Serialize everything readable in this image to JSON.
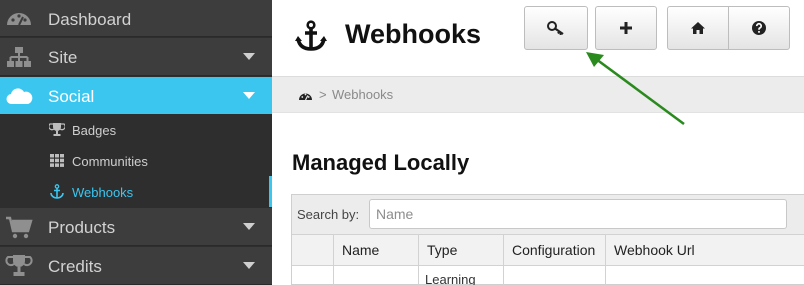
{
  "sidebar": {
    "items": [
      {
        "label": "Dashboard",
        "icon": "dashboard-icon"
      },
      {
        "label": "Site",
        "icon": "sitemap-icon"
      },
      {
        "label": "Social",
        "icon": "cloud-icon"
      },
      {
        "label": "Products",
        "icon": "cart-icon"
      },
      {
        "label": "Credits",
        "icon": "trophy-icon"
      }
    ],
    "social_sub": [
      {
        "label": "Badges",
        "icon": "trophy-icon"
      },
      {
        "label": "Communities",
        "icon": "grid-icon"
      },
      {
        "label": "Webhooks",
        "icon": "anchor-icon"
      }
    ]
  },
  "header": {
    "title": "Webhooks",
    "title_icon": "anchor-icon",
    "buttons": [
      {
        "name": "key",
        "icon": "key-icon"
      },
      {
        "name": "add",
        "icon": "plus-icon"
      },
      {
        "name": "home",
        "icon": "home-icon"
      },
      {
        "name": "help",
        "icon": "question-icon"
      }
    ]
  },
  "breadcrumb": {
    "separator": ">",
    "current": "Webhooks",
    "icon": "dashboard-icon"
  },
  "main": {
    "section_title": "Managed Locally",
    "search": {
      "label": "Search by:",
      "placeholder": "Name",
      "value": ""
    },
    "columns": [
      "",
      "Name",
      "Type",
      "Configuration",
      "Webhook Url"
    ],
    "rows": [
      [
        "",
        "",
        "Learning",
        "",
        ""
      ]
    ]
  },
  "colors": {
    "accent": "#3bc6f0",
    "sidebar_bg": "#2e2e2e",
    "annotation_arrow": "#2a8a1e"
  }
}
